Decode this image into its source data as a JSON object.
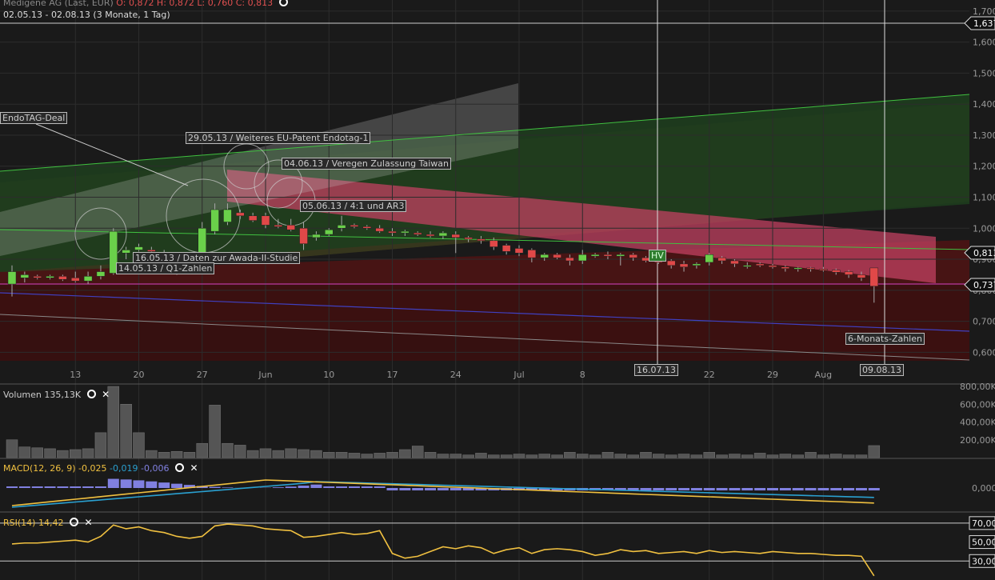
{
  "header": {
    "instrument": "Medigene AG (Last, EUR)",
    "ohlc": "O: 0,872  H: 0,872  L: 0,760  C: 0,813",
    "range": "02.05.13 - 02.08.13 (3 Monate, 1 Tag)"
  },
  "colors": {
    "background": "#1a1a1a",
    "up_candle": "#6ad04a",
    "down_candle": "#e04848",
    "grid": "#2c2c2c",
    "volume": "#555555",
    "macd_line": "#f0c040",
    "signal_line": "#2aa0d0",
    "histogram": "#8080e0",
    "rsi_line": "#f0c040"
  },
  "annotations": {
    "endotag_deal": "EndoTAG-Deal",
    "patent": "29.05.13 / Weiteres EU-Patent Endotag-1",
    "taiwan": "04.06.13 / Veregen Zulassung Taiwan",
    "ar3": "05.06.13 /  4:1 und AR3",
    "awada": "16.05.13 / Daten zur Awada-II-Studie",
    "q1": "14.05.13 / Q1-Zahlen",
    "six_month": "6-Monats-Zahlen",
    "hv": "HV",
    "date_marker_1": "16.07.13",
    "date_marker_2": "09.08.13"
  },
  "price_labels": {
    "top": "1,637",
    "close": "0,813",
    "support": "0,737"
  },
  "volume_panel": {
    "title": "Volumen",
    "value": "135,13K"
  },
  "macd_panel": {
    "title": "MACD(12, 26, 9)",
    "macd": "-0,025",
    "signal": "-0,019",
    "hist": "-0,006"
  },
  "rsi_panel": {
    "title": "RSI(14)",
    "value": "14,42"
  },
  "chart_data": {
    "type": "candlestick",
    "y_ticks": [
      "1,700",
      "1,600",
      "1,500",
      "1,400",
      "1,300",
      "1,200",
      "1,100",
      "1,000",
      "0,900",
      "0,800",
      "0,700",
      "0,600"
    ],
    "ylim": [
      0.57,
      1.71
    ],
    "x_ticks": [
      "13",
      "20",
      "27",
      "Jun",
      "10",
      "17",
      "24",
      "Jul",
      "8",
      "22",
      "29",
      "Aug"
    ],
    "candles": [
      {
        "o": 0.82,
        "h": 0.88,
        "l": 0.78,
        "c": 0.86
      },
      {
        "o": 0.84,
        "h": 0.86,
        "l": 0.825,
        "c": 0.85
      },
      {
        "o": 0.845,
        "h": 0.85,
        "l": 0.835,
        "c": 0.84
      },
      {
        "o": 0.84,
        "h": 0.85,
        "l": 0.835,
        "c": 0.845
      },
      {
        "o": 0.845,
        "h": 0.85,
        "l": 0.83,
        "c": 0.835
      },
      {
        "o": 0.84,
        "h": 0.86,
        "l": 0.825,
        "c": 0.83
      },
      {
        "o": 0.83,
        "h": 0.86,
        "l": 0.82,
        "c": 0.845
      },
      {
        "o": 0.845,
        "h": 0.88,
        "l": 0.835,
        "c": 0.86
      },
      {
        "o": 0.855,
        "h": 1.0,
        "l": 0.85,
        "c": 0.99
      },
      {
        "o": 0.92,
        "h": 0.94,
        "l": 0.9,
        "c": 0.93
      },
      {
        "o": 0.93,
        "h": 0.95,
        "l": 0.925,
        "c": 0.94
      },
      {
        "o": 0.93,
        "h": 0.94,
        "l": 0.92,
        "c": 0.925
      },
      {
        "o": 0.92,
        "h": 0.93,
        "l": 0.9,
        "c": 0.905
      },
      {
        "o": 0.91,
        "h": 0.92,
        "l": 0.85,
        "c": 0.865
      },
      {
        "o": 0.885,
        "h": 0.9,
        "l": 0.875,
        "c": 0.895
      },
      {
        "o": 0.89,
        "h": 1.02,
        "l": 0.88,
        "c": 1.0
      },
      {
        "o": 0.99,
        "h": 1.08,
        "l": 0.98,
        "c": 1.06
      },
      {
        "o": 1.02,
        "h": 1.08,
        "l": 1.01,
        "c": 1.06
      },
      {
        "o": 1.05,
        "h": 1.06,
        "l": 1.03,
        "c": 1.04
      },
      {
        "o": 1.04,
        "h": 1.05,
        "l": 1.02,
        "c": 1.025
      },
      {
        "o": 1.04,
        "h": 1.05,
        "l": 1.0,
        "c": 1.01
      },
      {
        "o": 1.01,
        "h": 1.03,
        "l": 1.0,
        "c": 1.005
      },
      {
        "o": 1.01,
        "h": 1.03,
        "l": 0.99,
        "c": 0.995
      },
      {
        "o": 1.0,
        "h": 1.02,
        "l": 0.93,
        "c": 0.95
      },
      {
        "o": 0.97,
        "h": 0.99,
        "l": 0.96,
        "c": 0.98
      },
      {
        "o": 0.98,
        "h": 1.0,
        "l": 0.975,
        "c": 0.995
      },
      {
        "o": 1.0,
        "h": 1.04,
        "l": 0.99,
        "c": 1.01
      },
      {
        "o": 1.01,
        "h": 1.015,
        "l": 1.0,
        "c": 1.005
      },
      {
        "o": 1.005,
        "h": 1.01,
        "l": 0.995,
        "c": 1.0
      },
      {
        "o": 1.0,
        "h": 1.01,
        "l": 0.985,
        "c": 0.99
      },
      {
        "o": 0.99,
        "h": 1.0,
        "l": 0.975,
        "c": 0.985
      },
      {
        "o": 0.985,
        "h": 0.995,
        "l": 0.975,
        "c": 0.99
      },
      {
        "o": 0.985,
        "h": 0.99,
        "l": 0.975,
        "c": 0.98
      },
      {
        "o": 0.98,
        "h": 0.99,
        "l": 0.97,
        "c": 0.975
      },
      {
        "o": 0.975,
        "h": 0.99,
        "l": 0.965,
        "c": 0.985
      },
      {
        "o": 0.98,
        "h": 0.99,
        "l": 0.92,
        "c": 0.97
      },
      {
        "o": 0.97,
        "h": 0.975,
        "l": 0.955,
        "c": 0.965
      },
      {
        "o": 0.965,
        "h": 0.975,
        "l": 0.95,
        "c": 0.96
      },
      {
        "o": 0.96,
        "h": 0.97,
        "l": 0.93,
        "c": 0.94
      },
      {
        "o": 0.945,
        "h": 0.95,
        "l": 0.915,
        "c": 0.925
      },
      {
        "o": 0.935,
        "h": 0.945,
        "l": 0.91,
        "c": 0.92
      },
      {
        "o": 0.93,
        "h": 0.935,
        "l": 0.89,
        "c": 0.905
      },
      {
        "o": 0.905,
        "h": 0.92,
        "l": 0.895,
        "c": 0.915
      },
      {
        "o": 0.915,
        "h": 0.92,
        "l": 0.9,
        "c": 0.905
      },
      {
        "o": 0.905,
        "h": 0.915,
        "l": 0.88,
        "c": 0.895
      },
      {
        "o": 0.895,
        "h": 0.93,
        "l": 0.885,
        "c": 0.915
      },
      {
        "o": 0.91,
        "h": 0.92,
        "l": 0.905,
        "c": 0.915
      },
      {
        "o": 0.915,
        "h": 0.925,
        "l": 0.9,
        "c": 0.91
      },
      {
        "o": 0.91,
        "h": 0.92,
        "l": 0.88,
        "c": 0.915
      },
      {
        "o": 0.915,
        "h": 0.92,
        "l": 0.895,
        "c": 0.905
      },
      {
        "o": 0.905,
        "h": 0.91,
        "l": 0.89,
        "c": 0.895
      },
      {
        "o": 0.895,
        "h": 0.905,
        "l": 0.885,
        "c": 0.89
      },
      {
        "o": 0.895,
        "h": 0.9,
        "l": 0.87,
        "c": 0.88
      },
      {
        "o": 0.885,
        "h": 0.895,
        "l": 0.86,
        "c": 0.875
      },
      {
        "o": 0.88,
        "h": 0.89,
        "l": 0.87,
        "c": 0.885
      },
      {
        "o": 0.89,
        "h": 0.92,
        "l": 0.88,
        "c": 0.915
      },
      {
        "o": 0.905,
        "h": 0.91,
        "l": 0.885,
        "c": 0.895
      },
      {
        "o": 0.895,
        "h": 0.9,
        "l": 0.875,
        "c": 0.885
      },
      {
        "o": 0.88,
        "h": 0.89,
        "l": 0.87,
        "c": 0.88
      },
      {
        "o": 0.885,
        "h": 0.89,
        "l": 0.875,
        "c": 0.88
      },
      {
        "o": 0.88,
        "h": 0.885,
        "l": 0.87,
        "c": 0.875
      },
      {
        "o": 0.875,
        "h": 0.88,
        "l": 0.86,
        "c": 0.87
      },
      {
        "o": 0.87,
        "h": 0.875,
        "l": 0.86,
        "c": 0.872
      },
      {
        "o": 0.872,
        "h": 0.875,
        "l": 0.86,
        "c": 0.868
      },
      {
        "o": 0.868,
        "h": 0.875,
        "l": 0.86,
        "c": 0.865
      },
      {
        "o": 0.865,
        "h": 0.87,
        "l": 0.85,
        "c": 0.858
      },
      {
        "o": 0.86,
        "h": 0.865,
        "l": 0.84,
        "c": 0.85
      },
      {
        "o": 0.85,
        "h": 0.86,
        "l": 0.83,
        "c": 0.84
      },
      {
        "o": 0.872,
        "h": 0.872,
        "l": 0.76,
        "c": 0.813
      }
    ],
    "volume": [
      {
        "v": 200000
      },
      {
        "v": 120000
      },
      {
        "v": 110000
      },
      {
        "v": 100000
      },
      {
        "v": 80000
      },
      {
        "v": 90000
      },
      {
        "v": 100000
      },
      {
        "v": 280000
      },
      {
        "v": 800000
      },
      {
        "v": 600000
      },
      {
        "v": 280000
      },
      {
        "v": 80000
      },
      {
        "v": 60000
      },
      {
        "v": 70000
      },
      {
        "v": 60000
      },
      {
        "v": 160000
      },
      {
        "v": 590000
      },
      {
        "v": 160000
      },
      {
        "v": 140000
      },
      {
        "v": 80000
      },
      {
        "v": 100000
      },
      {
        "v": 80000
      },
      {
        "v": 100000
      },
      {
        "v": 90000
      },
      {
        "v": 80000
      },
      {
        "v": 60000
      },
      {
        "v": 60000
      },
      {
        "v": 50000
      },
      {
        "v": 40000
      },
      {
        "v": 50000
      },
      {
        "v": 60000
      },
      {
        "v": 90000
      },
      {
        "v": 130000
      },
      {
        "v": 60000
      },
      {
        "v": 40000
      },
      {
        "v": 40000
      },
      {
        "v": 30000
      },
      {
        "v": 50000
      },
      {
        "v": 30000
      },
      {
        "v": 30000
      },
      {
        "v": 40000
      },
      {
        "v": 30000
      },
      {
        "v": 40000
      },
      {
        "v": 30000
      },
      {
        "v": 60000
      },
      {
        "v": 40000
      },
      {
        "v": 30000
      },
      {
        "v": 60000
      },
      {
        "v": 40000
      },
      {
        "v": 30000
      },
      {
        "v": 60000
      },
      {
        "v": 40000
      },
      {
        "v": 30000
      },
      {
        "v": 40000
      },
      {
        "v": 30000
      },
      {
        "v": 60000
      },
      {
        "v": 30000
      },
      {
        "v": 40000
      },
      {
        "v": 30000
      },
      {
        "v": 50000
      },
      {
        "v": 30000
      },
      {
        "v": 40000
      },
      {
        "v": 30000
      },
      {
        "v": 60000
      },
      {
        "v": 30000
      },
      {
        "v": 40000
      },
      {
        "v": 30000
      },
      {
        "v": 30000
      },
      {
        "v": 135130
      }
    ],
    "volume_ticks": [
      "800,00K",
      "600,00K",
      "400,00K",
      "200,00K"
    ],
    "macd_ticks": [
      "0,000"
    ],
    "rsi_ticks": [
      "70,00",
      "50,00",
      "30,00"
    ],
    "rsi": [
      48,
      49,
      49,
      50,
      51,
      52,
      50,
      56,
      68,
      64,
      66,
      62,
      60,
      56,
      54,
      56,
      67,
      69,
      68,
      67,
      64,
      63,
      62,
      55,
      56,
      58,
      60,
      58,
      59,
      62,
      38,
      33,
      35,
      40,
      45,
      43,
      46,
      44,
      38,
      42,
      44,
      38,
      42,
      43,
      42,
      40,
      36,
      38,
      42,
      40,
      41,
      38,
      39,
      40,
      38,
      41,
      39,
      40,
      39,
      38,
      40,
      39,
      38,
      38,
      37,
      36,
      36,
      35,
      14.42
    ]
  }
}
